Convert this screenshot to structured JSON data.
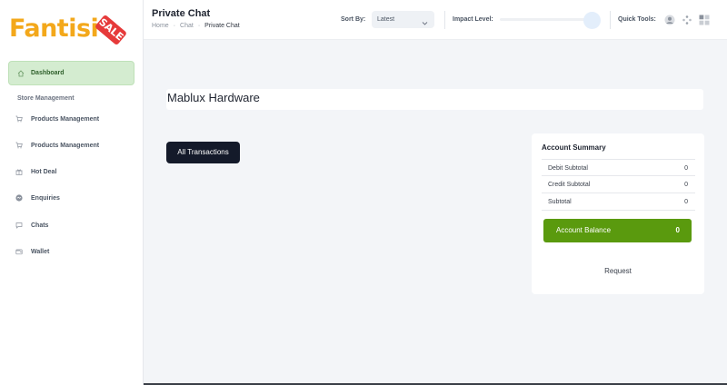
{
  "brand": {
    "name": "Fantisi",
    "badge": "SALE",
    "primary_color": "#f3a81b",
    "badge_color": "#e63a3a"
  },
  "sidebar": {
    "dashboard": {
      "label": "Dashboard",
      "icon": "home-icon"
    },
    "section_title": "Store Management",
    "items": [
      {
        "label": "Products Management",
        "icon": "cart-icon"
      },
      {
        "label": "Products Management",
        "icon": "cart-icon"
      },
      {
        "label": "Hot Deal",
        "icon": "gift-icon"
      },
      {
        "label": "Enquiries",
        "icon": "message-icon"
      },
      {
        "label": "Chats",
        "icon": "chat-bubble-icon"
      },
      {
        "label": "Wallet",
        "icon": "wallet-icon"
      }
    ]
  },
  "header": {
    "title": "Private Chat",
    "breadcrumb": [
      "Home",
      "Chat",
      "Private Chat"
    ],
    "sort_label": "Sort By:",
    "sort_value": "Latest",
    "impact_label": "Impact Level:",
    "impact_level": 0,
    "quick_tools_label": "Quick Tools:",
    "quick_tools": [
      "avatar-icon",
      "dots-icon",
      "grid-icon"
    ]
  },
  "main": {
    "store_name": "Mablux Hardware",
    "all_transactions_label": "All Transactions",
    "summary": {
      "title": "Account Summary",
      "rows": [
        {
          "label": "Debit Subtotal",
          "value": "0"
        },
        {
          "label": "Credit Subtotal",
          "value": "0"
        },
        {
          "label": "Subtotal",
          "value": "0"
        }
      ],
      "balance_label": "Account Balance",
      "balance_value": "0",
      "balance_color": "#5a9a0e",
      "request_label": "Request"
    }
  }
}
